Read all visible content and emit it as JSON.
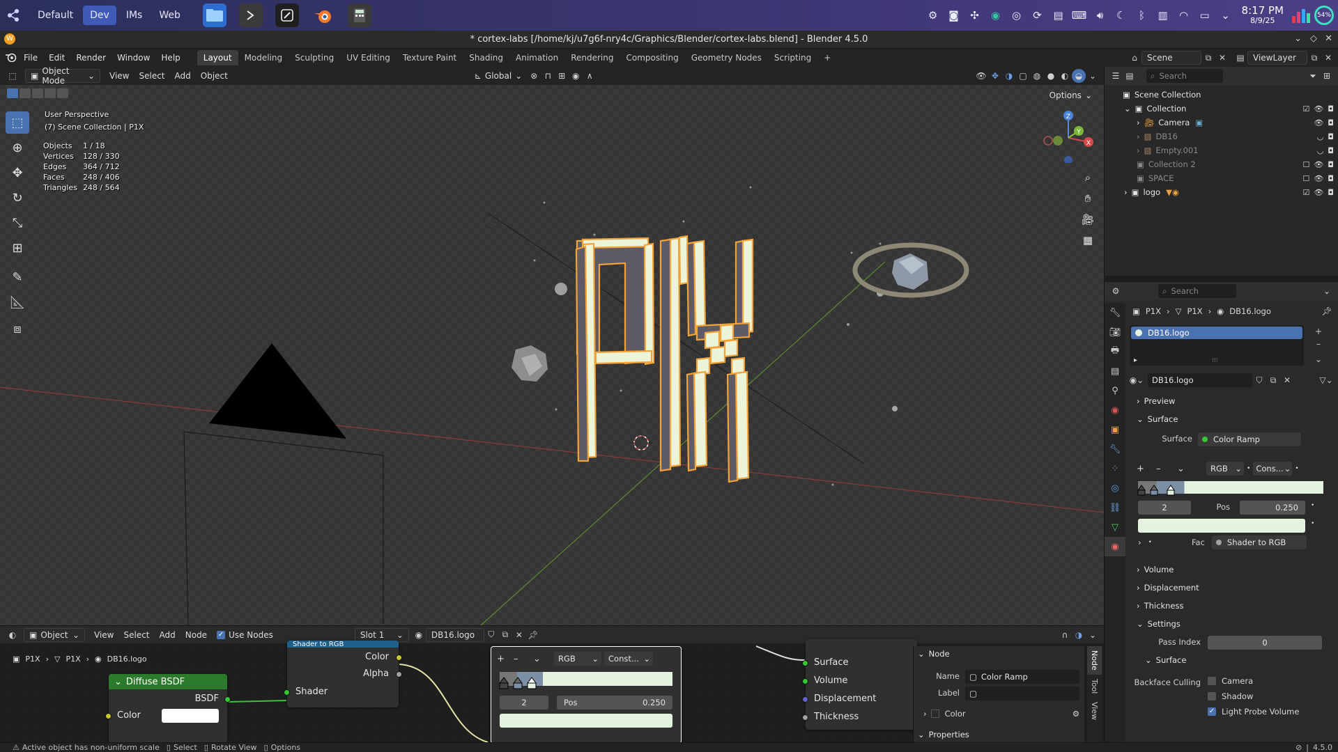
{
  "taskbar": {
    "workspaces": [
      "Default",
      "Dev",
      "IMs",
      "Web"
    ],
    "active_workspace": "Dev",
    "clock_time": "8:17 PM",
    "clock_date": "8/9/25",
    "battery": "54%"
  },
  "window": {
    "title": "* cortex-labs [/home/kj/u7g6f-nry4c/Graphics/Blender/cortex-labs.blend] - Blender 4.5.0"
  },
  "menu": {
    "items": [
      "File",
      "Edit",
      "Render",
      "Window",
      "Help"
    ],
    "workspaces": [
      "Layout",
      "Modeling",
      "Sculpting",
      "UV Editing",
      "Texture Paint",
      "Shading",
      "Animation",
      "Rendering",
      "Compositing",
      "Geometry Nodes",
      "Scripting"
    ],
    "active_workspace": "Layout",
    "add_tab": "+",
    "scene": "Scene",
    "view_layer": "ViewLayer"
  },
  "viewport": {
    "mode": "Object Mode",
    "menus": [
      "View",
      "Select",
      "Add",
      "Object"
    ],
    "transform": "Global",
    "options": "Options",
    "perspective": "User Perspective",
    "collection_info": "(7) Scene Collection | P1X",
    "stats": [
      {
        "label": "Objects",
        "value": "1 / 18"
      },
      {
        "label": "Vertices",
        "value": "128 / 330"
      },
      {
        "label": "Edges",
        "value": "364 / 712"
      },
      {
        "label": "Faces",
        "value": "248 / 406"
      },
      {
        "label": "Triangles",
        "value": "248 / 564"
      }
    ],
    "gizmo": {
      "x": "X",
      "y": "Y",
      "z": "Z"
    }
  },
  "outliner": {
    "search_placeholder": "Search",
    "rows": [
      {
        "label": "Scene Collection",
        "dim": false
      },
      {
        "label": "Collection",
        "dim": false
      },
      {
        "label": "Camera",
        "dim": false
      },
      {
        "label": "DB16",
        "dim": true
      },
      {
        "label": "Empty.001",
        "dim": true
      },
      {
        "label": "Collection 2",
        "dim": true
      },
      {
        "label": "SPACE",
        "dim": true
      },
      {
        "label": "logo",
        "dim": false
      }
    ]
  },
  "properties": {
    "search_placeholder": "Search",
    "breadcrumb": [
      "P1X",
      "P1X",
      "DB16.logo"
    ],
    "material_slot": "DB16.logo",
    "material_name": "DB16.logo",
    "panels": {
      "preview": "Preview",
      "surface": "Surface",
      "volume": "Volume",
      "displacement": "Displacement",
      "thickness": "Thickness",
      "settings": "Settings"
    },
    "surface_label": "Surface",
    "surface_value": "Color Ramp",
    "ramp_mode": "RGB",
    "ramp_interp": "Cons...",
    "ramp_index": "2",
    "ramp_pos_label": "Pos",
    "ramp_pos": "0.250",
    "fac_label": "Fac",
    "fac_value": "Shader to RGB",
    "pass_index_label": "Pass Index",
    "pass_index": "0",
    "settings_surface": "Surface",
    "backface_label": "Backface Culling",
    "backface_camera": "Camera",
    "backface_shadow": "Shadow",
    "light_probe": "Light Probe Volume"
  },
  "node_editor": {
    "object_type": "Object",
    "menus": [
      "View",
      "Select",
      "Add",
      "Node"
    ],
    "use_nodes": "Use Nodes",
    "slot": "Slot 1",
    "material": "DB16.logo",
    "breadcrumb": [
      "P1X",
      "P1X",
      "DB16.logo"
    ],
    "diffuse_title": "Diffuse BSDF",
    "diffuse_out": "BSDF",
    "diffuse_color": "Color",
    "str_title": "Shader to RGB",
    "str_color": "Color",
    "str_alpha": "Alpha",
    "str_shader": "Shader",
    "ramp_mode": "RGB",
    "ramp_interp": "Const...",
    "ramp_index": "2",
    "ramp_pos_label": "Pos",
    "ramp_pos": "0.250",
    "output_inputs": [
      "Surface",
      "Volume",
      "Displacement",
      "Thickness"
    ],
    "sidebar_node": "Node",
    "sidebar_name_label": "Name",
    "sidebar_name": "Color Ramp",
    "sidebar_label_label": "Label",
    "sidebar_color": "Color",
    "sidebar_properties": "Properties",
    "side_tabs": [
      "Node",
      "Tool",
      "View"
    ]
  },
  "statusbar": {
    "warning": "Active object has non-uniform scale",
    "select": "Select",
    "rotate": "Rotate View",
    "options": "Options",
    "version": "4.5.0"
  },
  "colors": {
    "accent": "#4a72b0",
    "ramp_light": "#e5f2df",
    "ramp_dark": "#7b8fa6",
    "letter_face": "#edf5d8",
    "letter_side": "#5f5b66",
    "letter_outline": "#f2a33a"
  }
}
